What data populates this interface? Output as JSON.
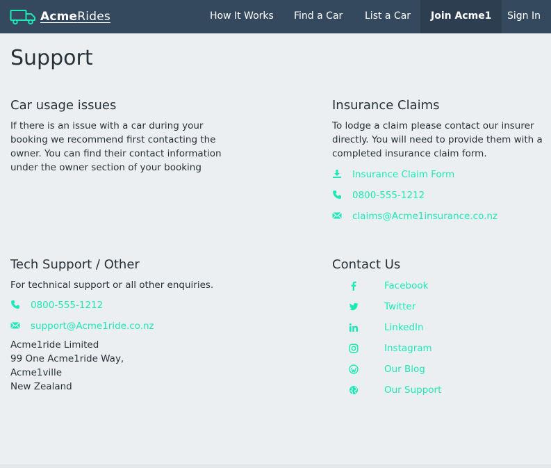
{
  "brand": {
    "name_bold": "Acme",
    "name_rest": "Rides"
  },
  "nav": {
    "items": [
      "How It Works",
      "Find a Car",
      "List a Car"
    ],
    "join": "Join Acme1",
    "signin": "Sign In"
  },
  "page": {
    "title": "Support"
  },
  "car_usage": {
    "heading": "Car usage issues",
    "lines": [
      "If there is an issue with a car during your",
      "booking we recommend first contacting the",
      "owner. You can find their contact information",
      "under the owner section of your booking"
    ]
  },
  "insurance": {
    "heading": "Insurance Claims",
    "lines": [
      "To lodge a claim please contact our insurer",
      "directly. You will need to provide them with a",
      "completed insurance claim form."
    ],
    "form_link": "Insurance Claim Form",
    "phone": "0800-555-1212",
    "email": "claims@Acme1insurance.co.nz"
  },
  "tech": {
    "heading": "Tech Support / Other",
    "text": "For technical support or all other enquiries.",
    "phone": "0800-555-1212",
    "email": "support@Acme1ride.co.nz",
    "address": [
      "Acme1ride Limited",
      "99 One Acme1ride Way,",
      "Acme1ville",
      "New Zealand"
    ]
  },
  "contact": {
    "heading": "Contact Us",
    "links": [
      {
        "label": "Facebook",
        "icon": "facebook-icon"
      },
      {
        "label": "Twitter",
        "icon": "twitter-icon"
      },
      {
        "label": "LinkedIn",
        "icon": "linkedin-icon"
      },
      {
        "label": "Instagram",
        "icon": "instagram-icon"
      },
      {
        "label": "Our Blog",
        "icon": "wordpress-icon"
      },
      {
        "label": "Our Support",
        "icon": "globe-icon"
      }
    ]
  },
  "colors": {
    "navbar": "#34495e",
    "navbar_active": "#2c3e50",
    "accent": "#1de9b6",
    "background": "#eceff1",
    "text": "#263238"
  }
}
